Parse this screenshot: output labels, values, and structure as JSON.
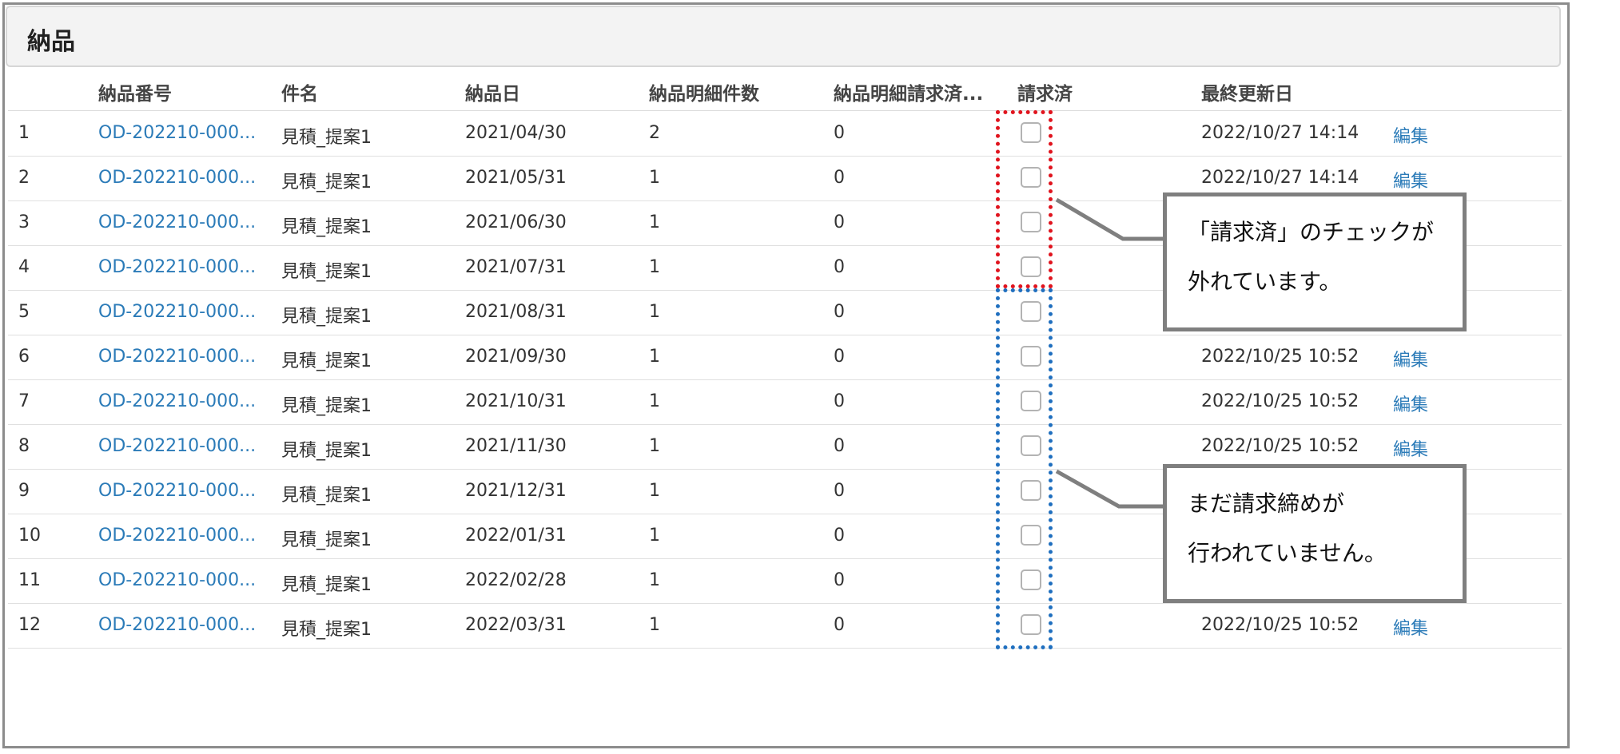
{
  "panel": {
    "title": "納品"
  },
  "columns": [
    "納品番号",
    "件名",
    "納品日",
    "納品明細件数",
    "納品明細請求済...",
    "請求済",
    "最終更新日"
  ],
  "rows": [
    {
      "no": "1",
      "number": "OD-202210-000...",
      "subject": "見積_提案1",
      "date": "2021/04/30",
      "count": "2",
      "billed_count": "0",
      "billed": false,
      "updated": "2022/10/27 14:14",
      "edit": "編集"
    },
    {
      "no": "2",
      "number": "OD-202210-000...",
      "subject": "見積_提案1",
      "date": "2021/05/31",
      "count": "1",
      "billed_count": "0",
      "billed": false,
      "updated": "2022/10/27 14:14",
      "edit": "編集"
    },
    {
      "no": "3",
      "number": "OD-202210-000...",
      "subject": "見積_提案1",
      "date": "2021/06/30",
      "count": "1",
      "billed_count": "0",
      "billed": false,
      "updated": "",
      "edit": ""
    },
    {
      "no": "4",
      "number": "OD-202210-000...",
      "subject": "見積_提案1",
      "date": "2021/07/31",
      "count": "1",
      "billed_count": "0",
      "billed": false,
      "updated": "",
      "edit": ""
    },
    {
      "no": "5",
      "number": "OD-202210-000...",
      "subject": "見積_提案1",
      "date": "2021/08/31",
      "count": "1",
      "billed_count": "0",
      "billed": false,
      "updated": "",
      "edit": ""
    },
    {
      "no": "6",
      "number": "OD-202210-000...",
      "subject": "見積_提案1",
      "date": "2021/09/30",
      "count": "1",
      "billed_count": "0",
      "billed": false,
      "updated": "2022/10/25 10:52",
      "edit": "編集"
    },
    {
      "no": "7",
      "number": "OD-202210-000...",
      "subject": "見積_提案1",
      "date": "2021/10/31",
      "count": "1",
      "billed_count": "0",
      "billed": false,
      "updated": "2022/10/25 10:52",
      "edit": "編集"
    },
    {
      "no": "8",
      "number": "OD-202210-000...",
      "subject": "見積_提案1",
      "date": "2021/11/30",
      "count": "1",
      "billed_count": "0",
      "billed": false,
      "updated": "2022/10/25 10:52",
      "edit": "編集"
    },
    {
      "no": "9",
      "number": "OD-202210-000...",
      "subject": "見積_提案1",
      "date": "2021/12/31",
      "count": "1",
      "billed_count": "0",
      "billed": false,
      "updated": "",
      "edit": ""
    },
    {
      "no": "10",
      "number": "OD-202210-000...",
      "subject": "見積_提案1",
      "date": "2022/01/31",
      "count": "1",
      "billed_count": "0",
      "billed": false,
      "updated": "",
      "edit": ""
    },
    {
      "no": "11",
      "number": "OD-202210-000...",
      "subject": "見積_提案1",
      "date": "2022/02/28",
      "count": "1",
      "billed_count": "0",
      "billed": false,
      "updated": "",
      "edit": ""
    },
    {
      "no": "12",
      "number": "OD-202210-000...",
      "subject": "見積_提案1",
      "date": "2022/03/31",
      "count": "1",
      "billed_count": "0",
      "billed": false,
      "updated": "2022/10/25 10:52",
      "edit": "編集"
    }
  ],
  "callouts": {
    "red": {
      "line1": "「請求済」のチェックが",
      "line2": "外れています。"
    },
    "blue": {
      "line1": "まだ請求締めが",
      "line2": "行われていません。"
    }
  },
  "colors": {
    "link": "#2b7bb8",
    "red_highlight": "#e0141e",
    "blue_highlight": "#1f6fbf",
    "callout_border": "#7f7f7f"
  }
}
